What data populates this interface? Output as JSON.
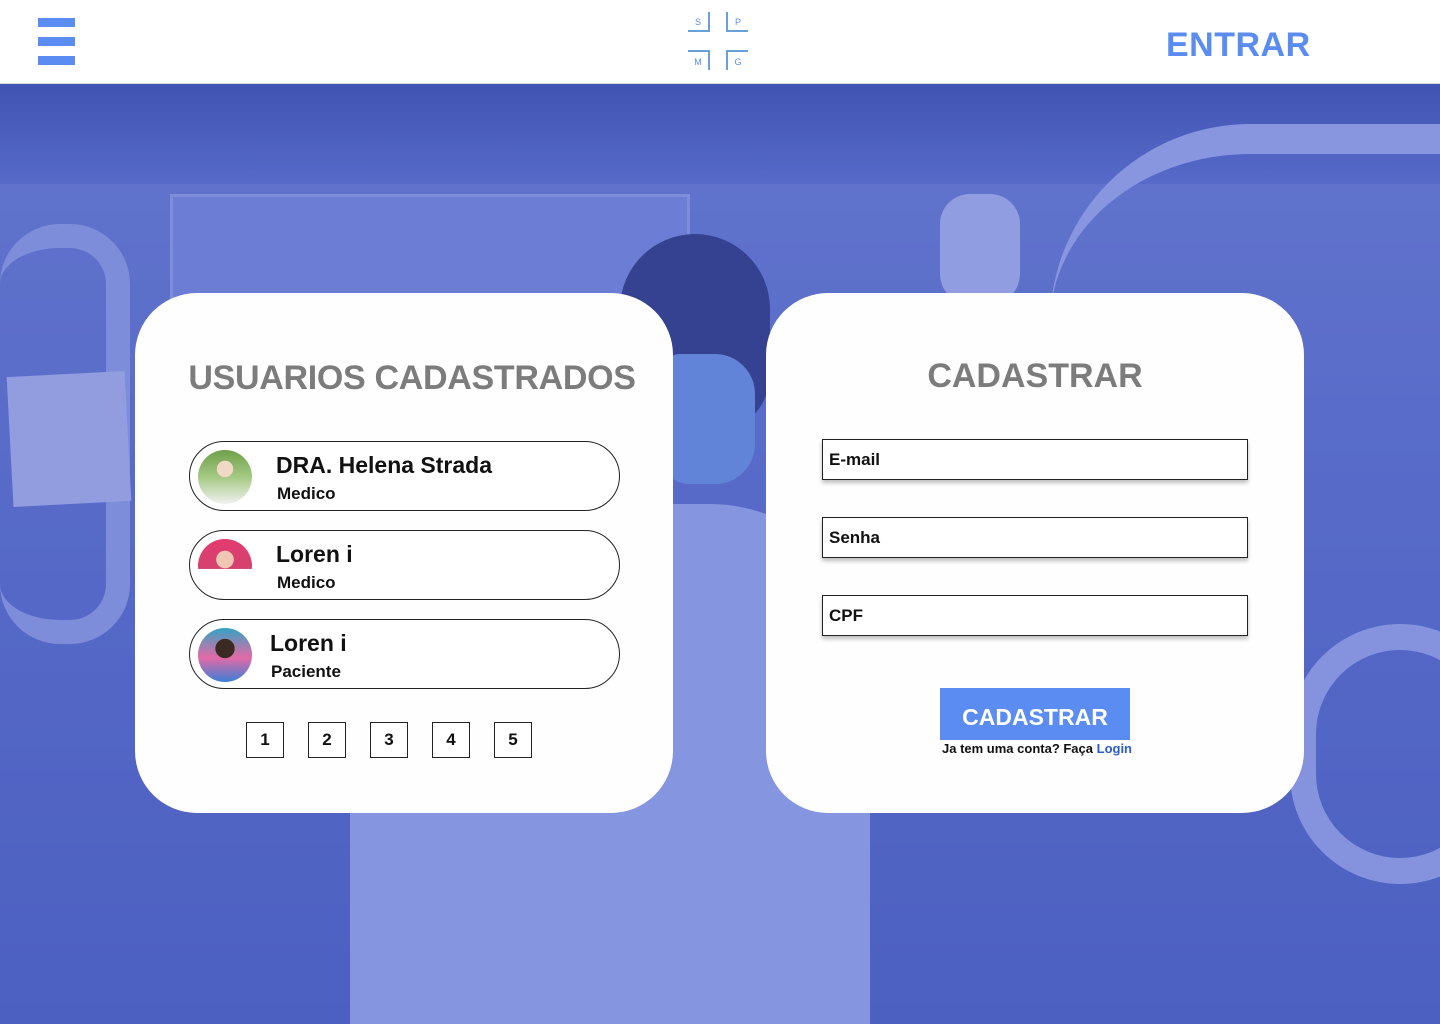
{
  "header": {
    "logo_letters": [
      "S",
      "P",
      "M",
      "G"
    ],
    "entrar_label": "ENTRAR",
    "accent_color": "#5b8cf2"
  },
  "users_panel": {
    "title": "USUARIOS CADASTRADOS",
    "users": [
      {
        "name": "DRA. Helena Strada",
        "role": "Medico"
      },
      {
        "name": "Loren i",
        "role": "Medico"
      },
      {
        "name": "Loren i",
        "role": "Paciente"
      }
    ],
    "pages": [
      "1",
      "2",
      "3",
      "4",
      "5"
    ]
  },
  "register_panel": {
    "title": "CADASTRAR",
    "email_placeholder": "E-mail",
    "password_placeholder": "Senha",
    "cpf_placeholder": "CPF",
    "submit_label": "CADASTRAR",
    "login_prompt": "Ja tem uma conta? Faça",
    "login_link": "Login"
  }
}
